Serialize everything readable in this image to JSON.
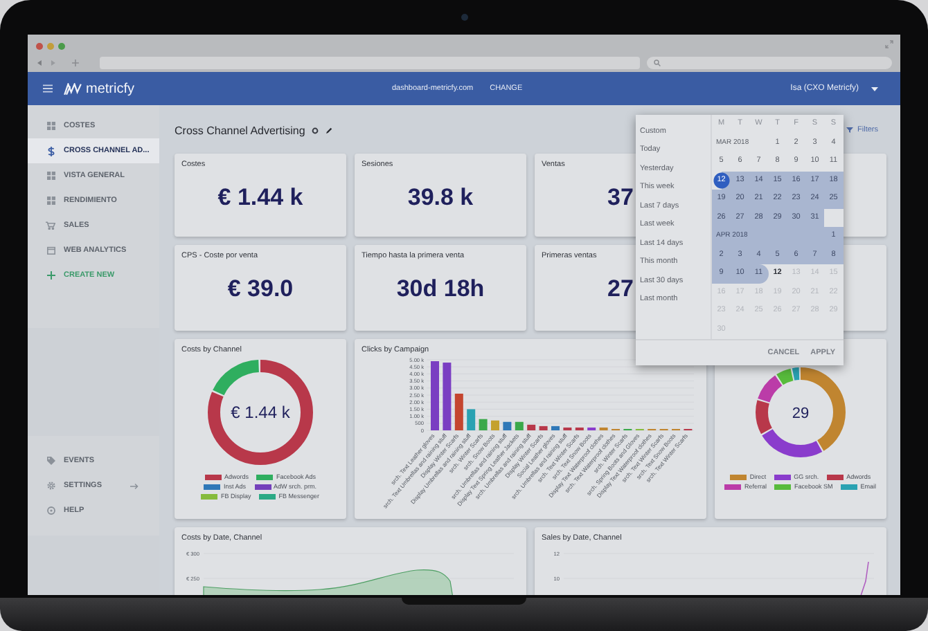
{
  "header": {
    "logo": "metricfy",
    "domain": "dashboard-metricfy.com",
    "change": "CHANGE",
    "user": "Isa (CXO Metricfy)"
  },
  "sidebar": {
    "items": [
      {
        "label": "COSTES",
        "kind": "page",
        "selected": false
      },
      {
        "label": "CROSS CHANNEL AD...",
        "kind": "page",
        "selected": true
      },
      {
        "label": "VISTA GENERAL",
        "kind": "page",
        "selected": false
      },
      {
        "label": "RENDIMIENTO",
        "kind": "page",
        "selected": false
      },
      {
        "label": "SALES",
        "kind": "page",
        "selected": false
      },
      {
        "label": "WEB ANALYTICS",
        "kind": "page",
        "selected": false
      },
      {
        "label": "CREATE NEW",
        "kind": "action",
        "selected": false
      }
    ],
    "bottom_items": [
      {
        "label": "EVENTS",
        "kind": "page",
        "selected": false
      },
      {
        "label": "SETTINGS",
        "kind": "submenu",
        "selected": false
      },
      {
        "label": "HELP",
        "kind": "page",
        "selected": false
      }
    ]
  },
  "page": {
    "title": "Cross Channel Advertising",
    "filters": "Filters"
  },
  "kpis": [
    {
      "label": "Costes",
      "value": "€ 1.44 k"
    },
    {
      "label": "Sesiones",
      "value": "39.8 k"
    },
    {
      "label": "Ventas",
      "value": "37"
    },
    {
      "label": "CPS - Coste por venta",
      "value": "€ 39.0"
    },
    {
      "label": "Tiempo hasta la primera venta",
      "value": "30d 18h"
    },
    {
      "label": "Primeras ventas",
      "value": "27"
    }
  ],
  "costs_by_channel": {
    "title": "Costs by Channel",
    "center": "€ 1.44 k",
    "legend": [
      {
        "label": "Adwords",
        "color": "#b8384a"
      },
      {
        "label": "Facebook Ads",
        "color": "#2fae5f"
      },
      {
        "label": "Inst Ads",
        "color": "#2f78b8"
      },
      {
        "label": "AdW srch. prm.",
        "color": "#7440bb"
      },
      {
        "label": "FB Display",
        "color": "#86bb3c"
      },
      {
        "label": "FB Messenger",
        "color": "#2aa985"
      }
    ]
  },
  "clicks_by_campaign": {
    "chart_data": {
      "type": "bar",
      "title": "Clicks by Campaign",
      "categories": [
        "srch. Text Leather gloves",
        "srch. Text Umbrellas and raining stuff",
        "Display Winter Scarfs",
        "Display Umbrellas and raining stuff",
        "srch. Winter Scarfs",
        "srch. Snow Boots",
        "srch. Umbrellas and raining stuff",
        "Display Text Spring Leather Jackets",
        "srch. Umbrellas and raining stuff",
        "Display Winter Scarfs",
        "Social Leather gloves",
        "srch. Umbrellas and raining stuff",
        "srch. Text Winter Scarfs",
        "srch. Text Snow Boots",
        "Display Text Waterproof clothes",
        "srch. Text Waterproof clothes",
        "srch. Winter Scarfs",
        "srch. Spring Boots and Gloves",
        "Display Text Waterproof clothes",
        "srch. Text Winter Scarfs",
        "srch. Text Snow Boots",
        "srch. Text Winter Scarfs"
      ],
      "values": [
        4900,
        4800,
        2600,
        1500,
        800,
        700,
        600,
        600,
        400,
        300,
        300,
        200,
        200,
        200,
        200,
        100,
        100,
        100,
        100,
        100,
        100,
        100
      ],
      "ylim": [
        0,
        5000
      ],
      "grid": true,
      "yticks": [
        0,
        500,
        {
          "value": 1000,
          "label": "1.00 k"
        },
        {
          "value": 1500,
          "label": "1.50 k"
        },
        {
          "value": 2000,
          "label": "2.00 k"
        },
        {
          "value": 2500,
          "label": "2.50 k"
        },
        {
          "value": 3000,
          "label": "3.00 k"
        },
        {
          "value": 3500,
          "label": "3.50 k"
        },
        {
          "value": 4000,
          "label": "4.00 k"
        },
        {
          "value": 4500,
          "label": "4.50 k"
        },
        {
          "value": 5000,
          "label": "5.00 k"
        }
      ]
    }
  },
  "traffic_donut": {
    "center": "29",
    "legend": [
      {
        "label": "Direct",
        "color": "#c08530"
      },
      {
        "label": "GG srch.",
        "color": "#8a3ccc"
      },
      {
        "label": "Adwords",
        "color": "#b8384a"
      },
      {
        "label": "Referral",
        "color": "#bb3ca8"
      },
      {
        "label": "Facebook SM",
        "color": "#58bb3c"
      },
      {
        "label": "Email",
        "color": "#2aa2b2"
      }
    ]
  },
  "costs_by_date": {
    "title": "Costs by Date, Channel",
    "y_ticks": [
      "€ 300",
      "€ 250"
    ]
  },
  "sales_by_date": {
    "title": "Sales by Date, Channel",
    "y_ticks": [
      "12",
      "10"
    ]
  },
  "date_picker": {
    "presets": [
      "Custom",
      "Today",
      "Yesterday",
      "This week",
      "Last 7 days",
      "Last week",
      "Last 14 days",
      "This month",
      "Last 30 days",
      "Last month"
    ],
    "weekdays": [
      "M",
      "T",
      "W",
      "T",
      "F",
      "S",
      "S"
    ],
    "rows": [
      {
        "month": "MAR 2018",
        "month_in_range": false,
        "cells": [
          null,
          null,
          null,
          {
            "day": "1",
            "kind": "normal"
          },
          {
            "day": "2",
            "kind": "normal"
          },
          {
            "day": "3",
            "kind": "normal"
          },
          {
            "day": "4",
            "kind": "normal"
          }
        ]
      },
      {
        "cells": [
          {
            "day": "5",
            "kind": "normal"
          },
          {
            "day": "6",
            "kind": "normal"
          },
          {
            "day": "7",
            "kind": "normal"
          },
          {
            "day": "8",
            "kind": "normal"
          },
          {
            "day": "9",
            "kind": "normal"
          },
          {
            "day": "10",
            "kind": "normal"
          },
          {
            "day": "11",
            "kind": "normal"
          }
        ]
      },
      {
        "cells": [
          {
            "day": "12",
            "kind": "selected"
          },
          {
            "day": "13",
            "kind": "range"
          },
          {
            "day": "14",
            "kind": "range"
          },
          {
            "day": "15",
            "kind": "range"
          },
          {
            "day": "16",
            "kind": "range"
          },
          {
            "day": "17",
            "kind": "range"
          },
          {
            "day": "18",
            "kind": "range"
          }
        ]
      },
      {
        "cells": [
          {
            "day": "19",
            "kind": "range"
          },
          {
            "day": "20",
            "kind": "range"
          },
          {
            "day": "21",
            "kind": "range"
          },
          {
            "day": "22",
            "kind": "range"
          },
          {
            "day": "23",
            "kind": "range"
          },
          {
            "day": "24",
            "kind": "range"
          },
          {
            "day": "25",
            "kind": "range"
          }
        ]
      },
      {
        "cells": [
          {
            "day": "26",
            "kind": "range"
          },
          {
            "day": "27",
            "kind": "range"
          },
          {
            "day": "28",
            "kind": "range"
          },
          {
            "day": "29",
            "kind": "range"
          },
          {
            "day": "30",
            "kind": "range"
          },
          {
            "day": "31",
            "kind": "range"
          },
          null
        ]
      },
      {
        "month": "APR 2018",
        "month_in_range": true,
        "cells": [
          null,
          null,
          null,
          null,
          null,
          null,
          {
            "day": "1",
            "kind": "range"
          }
        ]
      },
      {
        "cells": [
          {
            "day": "2",
            "kind": "range"
          },
          {
            "day": "3",
            "kind": "range"
          },
          {
            "day": "4",
            "kind": "range"
          },
          {
            "day": "5",
            "kind": "range"
          },
          {
            "day": "6",
            "kind": "range"
          },
          {
            "day": "7",
            "kind": "range"
          },
          {
            "day": "8",
            "kind": "range"
          }
        ]
      },
      {
        "cells": [
          {
            "day": "9",
            "kind": "range"
          },
          {
            "day": "10",
            "kind": "range"
          },
          {
            "day": "11",
            "kind": "range_end"
          },
          {
            "day": "12",
            "kind": "today"
          },
          {
            "day": "13",
            "kind": "disabled"
          },
          {
            "day": "14",
            "kind": "disabled"
          },
          {
            "day": "15",
            "kind": "disabled"
          }
        ]
      },
      {
        "cells": [
          {
            "day": "16",
            "kind": "disabled"
          },
          {
            "day": "17",
            "kind": "disabled"
          },
          {
            "day": "18",
            "kind": "disabled"
          },
          {
            "day": "19",
            "kind": "disabled"
          },
          {
            "day": "20",
            "kind": "disabled"
          },
          {
            "day": "21",
            "kind": "disabled"
          },
          {
            "day": "22",
            "kind": "disabled"
          }
        ]
      },
      {
        "cells": [
          {
            "day": "23",
            "kind": "disabled"
          },
          {
            "day": "24",
            "kind": "disabled"
          },
          {
            "day": "25",
            "kind": "disabled"
          },
          {
            "day": "26",
            "kind": "disabled"
          },
          {
            "day": "27",
            "kind": "disabled"
          },
          {
            "day": "28",
            "kind": "disabled"
          },
          {
            "day": "29",
            "kind": "disabled"
          }
        ]
      },
      {
        "cells": [
          {
            "day": "30",
            "kind": "disabled"
          },
          null,
          null,
          null,
          null,
          null,
          null
        ]
      }
    ],
    "cancel": "CANCEL",
    "apply": "APPLY"
  }
}
